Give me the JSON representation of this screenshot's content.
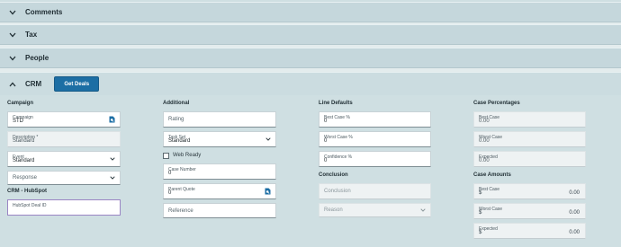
{
  "sections": {
    "comments": "Comments",
    "tax": "Tax",
    "people": "People",
    "crm": "CRM"
  },
  "crm": {
    "get_deals_label": "Get Deals",
    "campaign": {
      "title": "Campaign",
      "campaign_label": "Campaign",
      "campaign_value": "STD",
      "description_label": "Description *",
      "description_value": "Standard",
      "event_label": "Event",
      "event_value": "Standard",
      "response_placeholder": "Response"
    },
    "hubspot": {
      "title": "CRM - HubSpot",
      "deal_id_label": "HubSpot Deal ID"
    },
    "additional": {
      "title": "Additional",
      "rating_placeholder": "Rating",
      "task_set_label": "Task Set",
      "task_set_value": "Standard",
      "web_ready_label": "Web Ready",
      "case_number_label": "Case Number",
      "case_number_value": "0",
      "parent_quote_label": "Parent Quote",
      "parent_quote_value": "0",
      "reference_placeholder": "Reference"
    },
    "line_defaults": {
      "title": "Line Defaults",
      "best_case_label": "Best Case %",
      "best_case_value": "0",
      "worst_case_label": "Worst Case %",
      "worst_case_value": "0",
      "confidence_label": "Confidence %",
      "confidence_value": "0"
    },
    "conclusion": {
      "title": "Conclusion",
      "conclusion_placeholder": "Conclusion",
      "reason_placeholder": "Reason"
    },
    "case_percentages": {
      "title": "Case Percentages",
      "best_case_label": "Best Case",
      "best_case_value": "0.00",
      "worst_case_label": "Worst Case",
      "worst_case_value": "0.00",
      "expected_label": "Expected",
      "expected_value": "0.00"
    },
    "case_amounts": {
      "title": "Case Amounts",
      "currency": "$",
      "best_case_label": "Best Case",
      "best_case_value": "0.00",
      "worst_case_label": "Worst Case",
      "worst_case_value": "0.00",
      "expected_label": "Expected",
      "expected_value": "0.00"
    }
  },
  "colors": {
    "accent": "#1c6ea4",
    "section_bg": "#c5d7dc",
    "page_bg": "#cfdfe2"
  }
}
